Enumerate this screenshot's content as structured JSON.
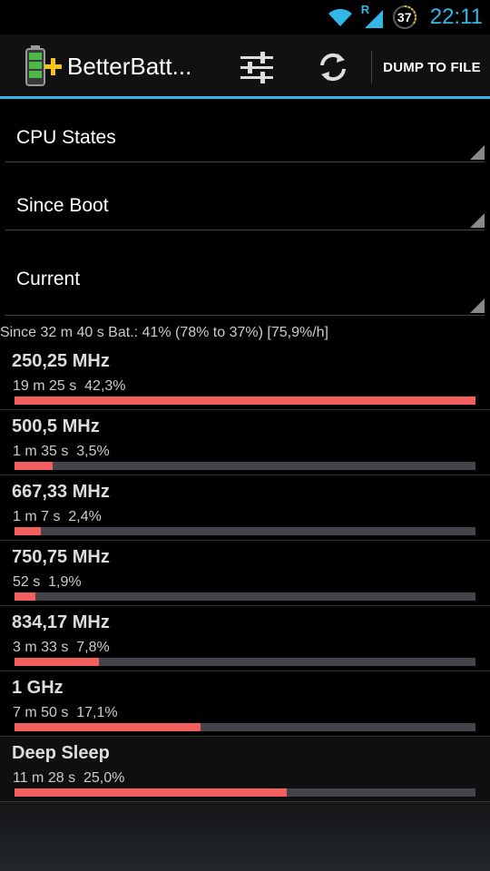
{
  "status_bar": {
    "clock": "22:11",
    "battery_level": "37",
    "network_indicator": "R",
    "icons": [
      "wifi-icon",
      "signal-icon",
      "battery-ring-icon"
    ],
    "accent_color": "#33b5e5"
  },
  "action_bar": {
    "title": "BetterBatt...",
    "dump_label": "DUMP TO FILE",
    "icons": [
      "battery-plus-icon",
      "sliders-icon",
      "refresh-icon"
    ]
  },
  "spinners": [
    {
      "value": "CPU States"
    },
    {
      "value": "Since Boot"
    },
    {
      "value": "Current"
    }
  ],
  "summary": "Since 32 m 40 s  Bat.: 41% (78% to 37%) [75,9%/h]",
  "states": [
    {
      "name": "250,25 MHz",
      "info": "19 m 25 s  42,3%",
      "fraction": 1.0
    },
    {
      "name": "500,5 MHz",
      "info": "1 m 35 s  3,5%",
      "fraction": 0.083
    },
    {
      "name": "667,33 MHz",
      "info": "1 m 7 s  2,4%",
      "fraction": 0.057
    },
    {
      "name": "750,75 MHz",
      "info": "52 s  1,9%",
      "fraction": 0.045
    },
    {
      "name": "834,17 MHz",
      "info": "3 m 33 s  7,8%",
      "fraction": 0.184
    },
    {
      "name": "1 GHz",
      "info": "7 m 50 s  17,1%",
      "fraction": 0.404
    },
    {
      "name": "Deep Sleep",
      "info": "11 m 28 s  25,0%",
      "fraction": 0.591
    }
  ],
  "colors": {
    "bar_fill": "#f25f5c",
    "bar_track": "#44444a"
  }
}
